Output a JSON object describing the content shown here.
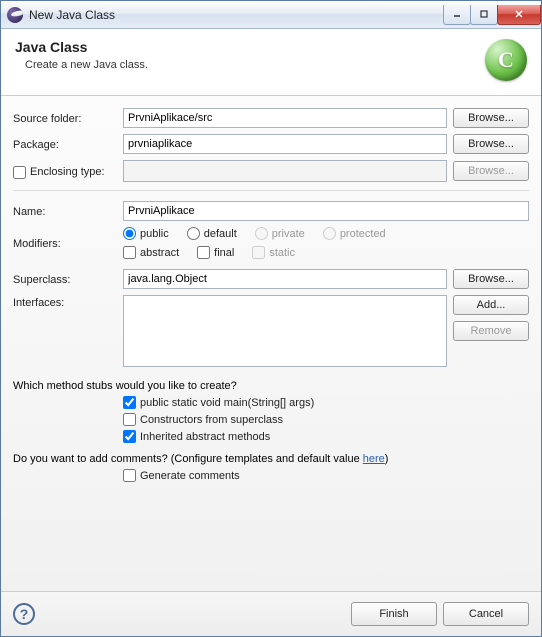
{
  "window": {
    "title": "New Java Class"
  },
  "header": {
    "title": "Java Class",
    "subtitle": "Create a new Java class."
  },
  "form": {
    "source_folder": {
      "label": "Source folder:",
      "value": "PrvniAplikace/src",
      "browse": "Browse..."
    },
    "package": {
      "label": "Package:",
      "value": "prvniaplikace",
      "browse": "Browse..."
    },
    "enclosing": {
      "label": "Enclosing type:",
      "value": "",
      "browse": "Browse...",
      "checked": false
    },
    "name": {
      "label": "Name:",
      "value": "PrvniAplikace"
    },
    "modifiers": {
      "label": "Modifiers:",
      "visibility": {
        "public": "public",
        "default": "default",
        "private": "private",
        "protected": "protected",
        "selected": "public"
      },
      "abstract": "abstract",
      "final": "final",
      "static": "static"
    },
    "superclass": {
      "label": "Superclass:",
      "value": "java.lang.Object",
      "browse": "Browse..."
    },
    "interfaces": {
      "label": "Interfaces:",
      "add": "Add...",
      "remove": "Remove"
    }
  },
  "stubs": {
    "question": "Which method stubs would you like to create?",
    "main": {
      "label": "public static void main(String[] args)",
      "checked": true
    },
    "constructors": {
      "label": "Constructors from superclass",
      "checked": false
    },
    "inherited": {
      "label": "Inherited abstract methods",
      "checked": true
    }
  },
  "comments": {
    "question_prefix": "Do you want to add comments? (Configure templates and default value ",
    "link": "here",
    "question_suffix": ")",
    "generate": {
      "label": "Generate comments",
      "checked": false
    }
  },
  "footer": {
    "finish": "Finish",
    "cancel": "Cancel"
  }
}
